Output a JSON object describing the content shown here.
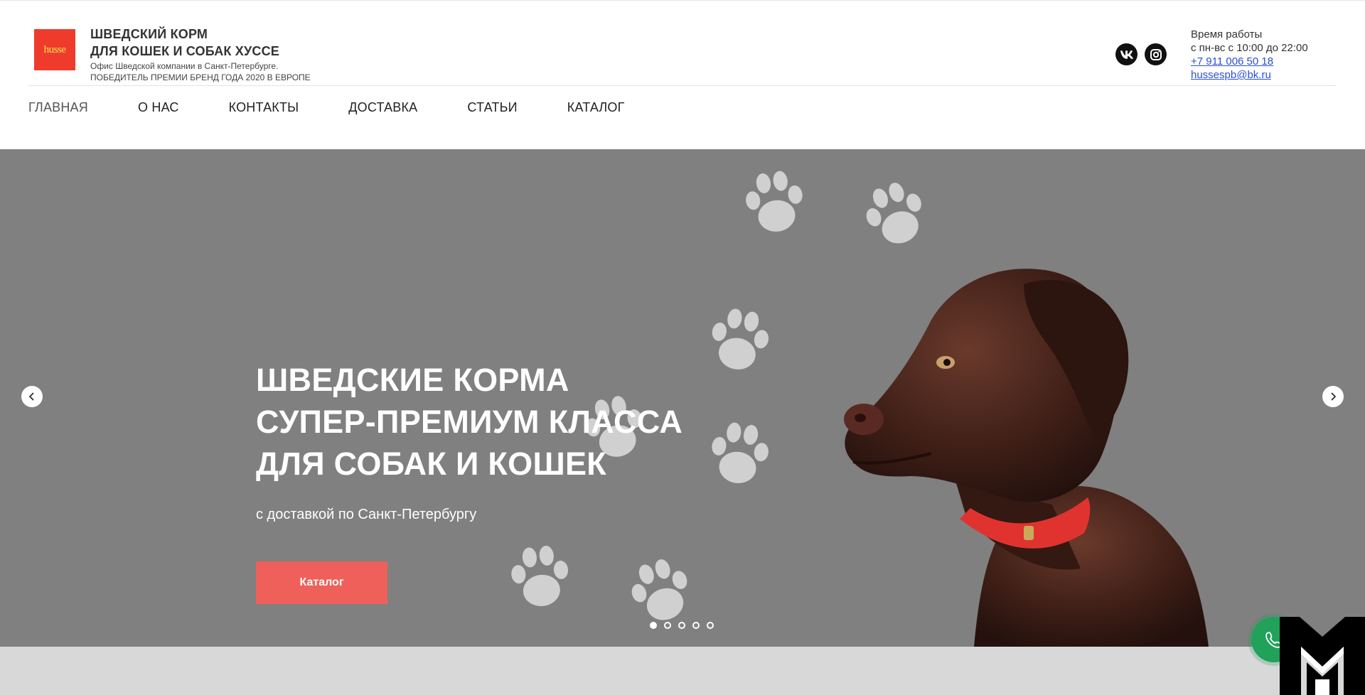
{
  "header": {
    "logo_text": "husse",
    "brand_title_line1": "ШВЕДСКИЙ КОРМ",
    "brand_title_line2": "ДЛЯ КОШЕК И СОБАК ХУССЕ",
    "brand_sub_line1": "Офис Шведской компании в Санкт-Петербурге.",
    "brand_sub_line2": "ПОБЕДИТЕЛЬ ПРЕМИИ БРЕНД ГОДА 2020 В ЕВРОПЕ",
    "socials": [
      {
        "icon": "vk-icon"
      },
      {
        "icon": "instagram-icon"
      }
    ],
    "contacts": {
      "hours_label": "Время работы",
      "hours_value": "с пн-вс с 10:00 до 22:00",
      "phone": "+7 911 006 50 18",
      "email": "hussespb@bk.ru"
    }
  },
  "nav": {
    "items": [
      {
        "label": "ГЛАВНАЯ"
      },
      {
        "label": "О НАС"
      },
      {
        "label": "КОНТАКТЫ"
      },
      {
        "label": "ДОСТАВКА"
      },
      {
        "label": "СТАТЬИ"
      },
      {
        "label": "КАТАЛОГ"
      }
    ]
  },
  "hero": {
    "title_line1": "ШВЕДСКИЕ КОРМА",
    "title_line2": "СУПЕР-ПРЕМИУМ КЛАССА",
    "title_line3": "ДЛЯ СОБАК И КОШЕК",
    "subtitle": "с доставкой по Санкт-Петербургу",
    "button_label": "Каталог",
    "slide_count": 5,
    "active_slide": 1,
    "background_color": "#808080",
    "button_color": "#f0605a"
  },
  "widgets": {
    "call_button_icon": "phone-icon",
    "call_button_color": "#21a15a",
    "corner_logo_icon": "brand-mark-icon"
  }
}
